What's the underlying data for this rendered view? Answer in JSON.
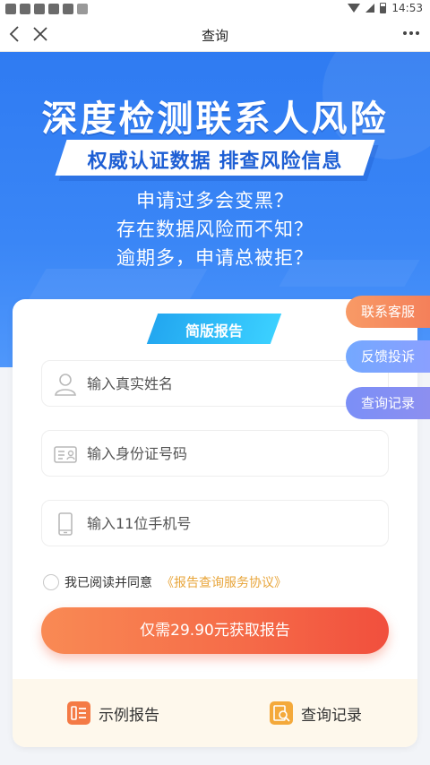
{
  "status_bar": {
    "time": "14:53"
  },
  "nav": {
    "title": "查询"
  },
  "banner": {
    "title": "深度检测联系人风险",
    "ribbon": "权威认证数据  排查风险信息",
    "question_1": "申请过多会变黑？",
    "question_2": "存在数据风险而不知？",
    "question_3": "逾期多，申请总被拒？"
  },
  "card": {
    "tag": "简版报告",
    "name_placeholder": "输入真实姓名",
    "id_placeholder": "输入身份证号码",
    "phone_placeholder": "输入11位手机号",
    "agree_text": "我已阅读并同意",
    "agree_link": "《报告查询服务协议》",
    "cta_label": "仅需29.90元获取报告"
  },
  "bottom": {
    "sample_label": "示例报告",
    "records_label": "查询记录"
  },
  "side": {
    "service": "联系客服",
    "feedback": "反馈投诉",
    "records": "查询记录"
  },
  "colors": {
    "banner_blue": "#3a86f6",
    "cta_orange": "#f56a48",
    "link_gold": "#e8a53a",
    "tag_cyan": "#23a7f0"
  }
}
